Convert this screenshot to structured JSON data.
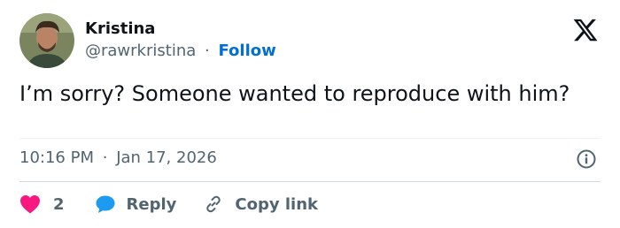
{
  "author": {
    "name": "Kristina",
    "handle": "@rawrkristina",
    "separator": "·",
    "follow_label": "Follow"
  },
  "tweet": {
    "text": "I’m sorry? Someone wanted to reproduce with him?",
    "time": "10:16 PM",
    "date_separator": "·",
    "date": "Jan 17, 2026"
  },
  "actions": {
    "like_count": "2",
    "reply_label": "Reply",
    "copy_label": "Copy link"
  },
  "icons": {
    "logo": "x-logo-icon",
    "info": "info-icon",
    "like": "heart-icon",
    "reply": "speech-bubble-icon",
    "copy": "link-icon"
  },
  "colors": {
    "accent": "#006fd6",
    "like": "#f91880",
    "reply": "#1d9bf0",
    "muted": "#536471",
    "text": "#0f1419"
  }
}
